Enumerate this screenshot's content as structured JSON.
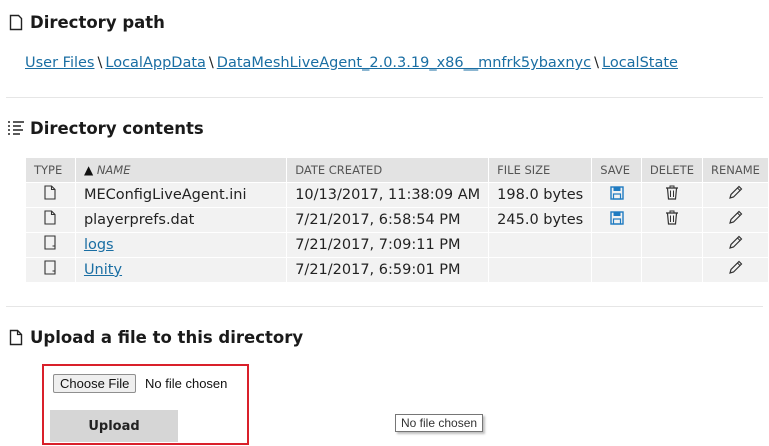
{
  "directory_path": {
    "title": "Directory path",
    "breadcrumb": [
      {
        "label": "User Files"
      },
      {
        "label": "LocalAppData"
      },
      {
        "label": "DataMeshLiveAgent_2.0.3.19_x86__mnfrk5ybaxnyc"
      },
      {
        "label": "LocalState"
      }
    ],
    "separator": "\\"
  },
  "directory_contents": {
    "title": "Directory contents",
    "columns": {
      "type": "TYPE",
      "name": "NAME",
      "name_sort_indicator": "▲",
      "date_created": "DATE CREATED",
      "file_size": "FILE SIZE",
      "save": "SAVE",
      "delete": "DELETE",
      "rename": "RENAME"
    },
    "rows": [
      {
        "type": "file",
        "name": "MEConfigLiveAgent.ini",
        "link": false,
        "date_created": "10/13/2017, 11:38:09 AM",
        "file_size": "198.0 bytes",
        "save": true,
        "delete": true,
        "rename": true
      },
      {
        "type": "file",
        "name": "playerprefs.dat",
        "link": false,
        "date_created": "7/21/2017, 6:58:54 PM",
        "file_size": "245.0 bytes",
        "save": true,
        "delete": true,
        "rename": true
      },
      {
        "type": "folder",
        "name": "logs",
        "link": true,
        "date_created": "7/21/2017, 7:09:11 PM",
        "file_size": "",
        "save": false,
        "delete": false,
        "rename": true
      },
      {
        "type": "folder",
        "name": "Unity",
        "link": true,
        "date_created": "7/21/2017, 6:59:01 PM",
        "file_size": "",
        "save": false,
        "delete": false,
        "rename": true
      }
    ]
  },
  "upload": {
    "title": "Upload a file to this directory",
    "choose_file_label": "Choose File",
    "no_file_text": "No file chosen",
    "upload_label": "Upload",
    "tooltip": "No file chosen"
  },
  "colors": {
    "link": "#1a6ea3",
    "save_icon": "#1f7bc1",
    "highlight_border": "#d9202a"
  }
}
